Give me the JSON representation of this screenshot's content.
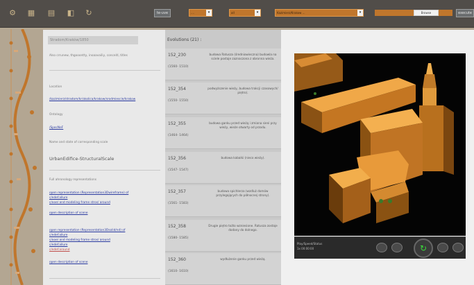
{
  "toolbar": {
    "icons": [
      "gear-icon",
      "grid-icon",
      "document-icon",
      "layers-icon",
      "refresh-icon"
    ],
    "mode_button": "te-uve",
    "select_1": "....",
    "select_2": "all",
    "select_3": "Kazimierz/Krakow ...",
    "search_value": "Browse",
    "right_button": "execute"
  },
  "info_panel": {
    "title_placeholder": "Stradom/Kraków/1850",
    "subtitle": "Also crrunew, thgooontty, inoaavailiy, conceitl, titles",
    "location_label": "Location",
    "location_link": "/kazimierz/stradom/kr/okolica/krakow/srodmiescie/krakow",
    "ontology_label": "Ontology",
    "ontology_link": "/SpecNeF",
    "name_label": "Name and state of corresponding scale",
    "scale_value": "UrbanEdifice-StructuralScale",
    "full_repr_label": "Full ahronology representations",
    "repr1_lines": [
      "open representation (Representation3Dwireframe) of",
      "c/edef.allure",
      "c/ooe/ and modeling frame stros/ around"
    ],
    "repr1_more": "open description of scene",
    "repr2_lines": [
      "open representation (Representation3Dsolid/nd) of",
      "c/edef.allure",
      "c/ooe/ and modeling frame stros/ around",
      "c/edef.allure"
    ],
    "repr2_red": "c/edef.around",
    "repr2_more": "open description of scene"
  },
  "evolutions": {
    "header": "Evolutions (21) :",
    "items": [
      {
        "id": "152_230",
        "years": "(1560- 1510)",
        "desc": "budowa Ratusza (średniowieczna) budowla na sciele postaje zaznaczona z obronna wieża."
      },
      {
        "id": "152_354",
        "years": "(1550- 1550)",
        "desc": "podwyższenie wieży, budowa trakcji czasowych/ piętro)."
      },
      {
        "id": "152_355",
        "years": "(1464- 1464)",
        "desc": "budowa ganku przed wieżą i zmiana sieni przy wieży, wieże otwarty od przodu."
      },
      {
        "id": "152_356",
        "years": "(1547- 1547)",
        "desc": "budowa kabalki (nieco wieży)."
      },
      {
        "id": "152_357",
        "years": "(1561- 1583)",
        "desc": "budowa spichlerza (wzdluż domów przylegających do północnej strony)."
      },
      {
        "id": "152_358",
        "years": "(1580- 1585)",
        "desc": "Drugie piętro tożto wzniesione. Ratusza zostaje dodany do dolnego."
      },
      {
        "id": "152_360",
        "years": "(1610- 1610)",
        "desc": "wydłużenie ganku przed wieżą."
      }
    ]
  },
  "viewer": {
    "controls_label_line1": "Play/Speed/Status",
    "controls_label_line2": "1x 00:00:00"
  }
}
